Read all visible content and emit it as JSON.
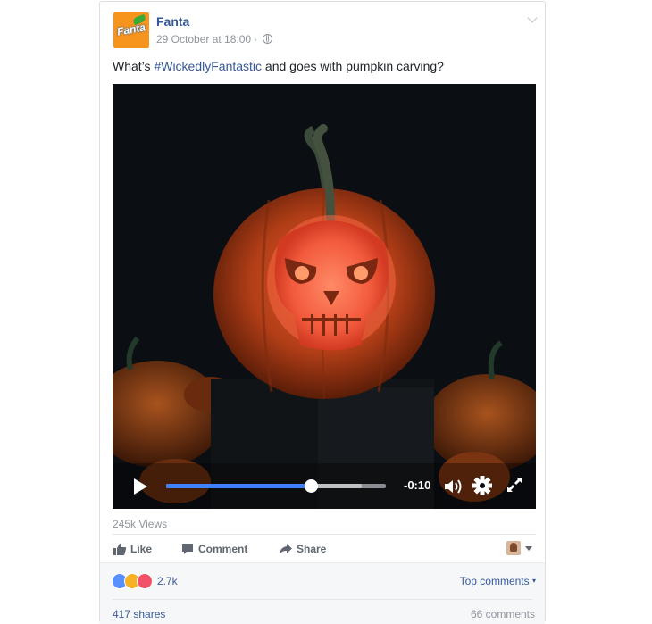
{
  "post": {
    "page_name": "Fanta",
    "logo_text": "Fanta",
    "timestamp": "29 October at 18:00 ·",
    "privacy_icon": "globe-icon",
    "menu_icon": "chevron-down-icon",
    "text_before": "What’s ",
    "hashtag": "#WickedlyFantastic",
    "text_after": " and goes with pumpkin carving?"
  },
  "video": {
    "time_remaining": "-0:10",
    "progress": 0.66,
    "buffered": 0.89,
    "icons": [
      "play-icon",
      "volume-icon",
      "settings-gear-icon",
      "fullscreen-icon"
    ]
  },
  "views": "245k Views",
  "actions": {
    "like": "Like",
    "comment": "Comment",
    "share": "Share"
  },
  "reactions": {
    "count": "2.7k",
    "types": [
      "like",
      "wow",
      "love"
    ],
    "colors": {
      "like": "#5890ff",
      "wow": "#f7b125",
      "love": "#f25268"
    }
  },
  "top_comments": "Top comments",
  "shares": "417 shares",
  "comments": "66 comments",
  "colors": {
    "link": "#365899",
    "brand_orange": "#f7941d",
    "progress": "#4080ff"
  }
}
